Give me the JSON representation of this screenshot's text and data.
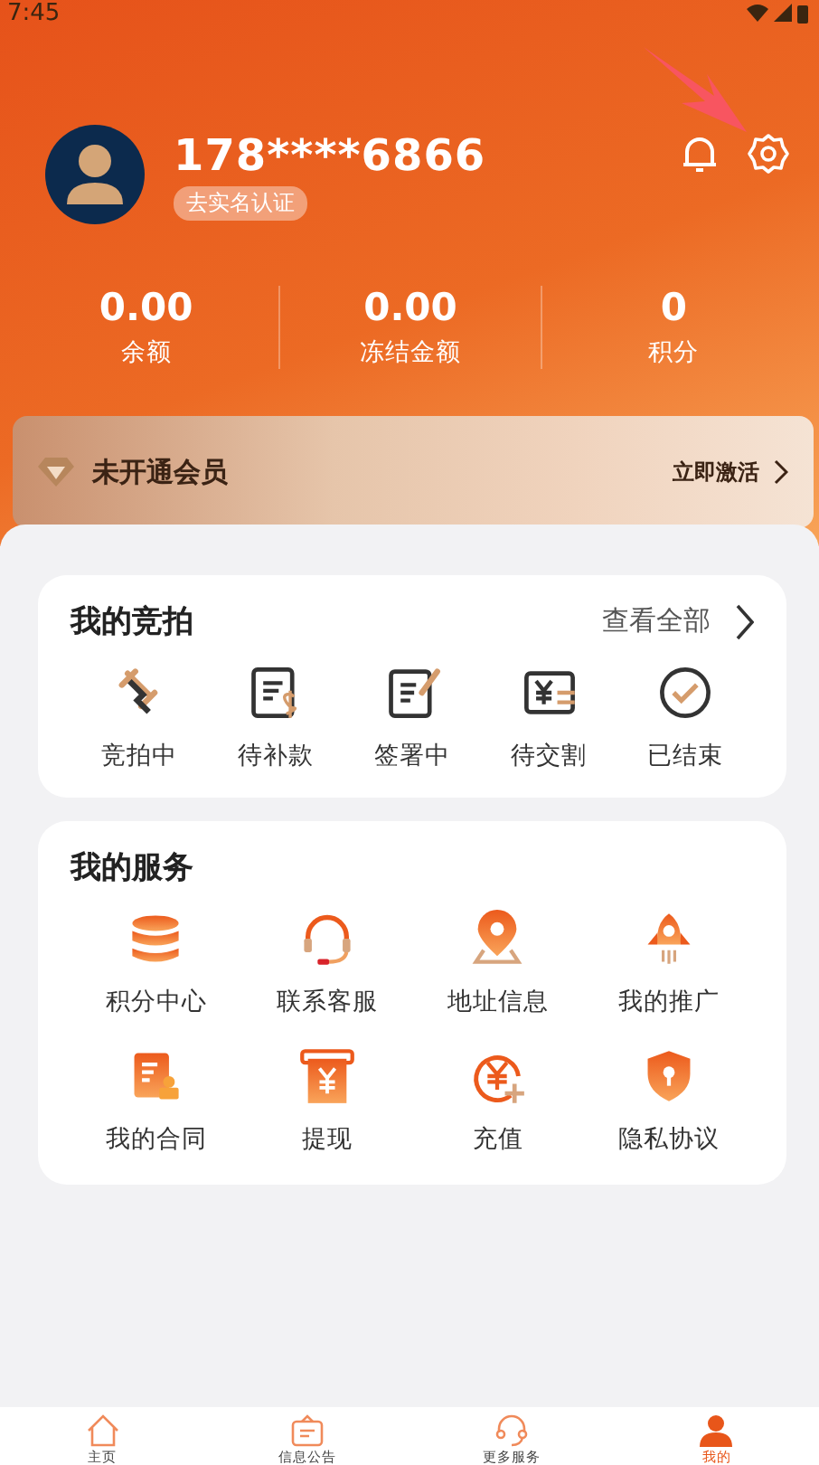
{
  "status_bar": {
    "time": "7:45"
  },
  "profile": {
    "phone": "178****6866",
    "verify_badge": "去实名认证"
  },
  "stats": [
    {
      "value": "0.00",
      "label": "余额"
    },
    {
      "value": "0.00",
      "label": "冻结金额"
    },
    {
      "value": "0",
      "label": "积分"
    }
  ],
  "membership": {
    "title": "未开通会员",
    "action": "立即激活"
  },
  "auctions": {
    "title": "我的竞拍",
    "view_all": "查看全部",
    "items": [
      "竞拍中",
      "待补款",
      "签署中",
      "待交割",
      "已结束"
    ]
  },
  "services": {
    "title": "我的服务",
    "items": [
      "积分中心",
      "联系客服",
      "地址信息",
      "我的推广",
      "我的合同",
      "提现",
      "充值",
      "隐私协议"
    ]
  },
  "bottom_nav": [
    {
      "label": "主页",
      "selected": false
    },
    {
      "label": "信息公告",
      "selected": false
    },
    {
      "label": "更多服务",
      "selected": false
    },
    {
      "label": "我的",
      "selected": true
    }
  ]
}
